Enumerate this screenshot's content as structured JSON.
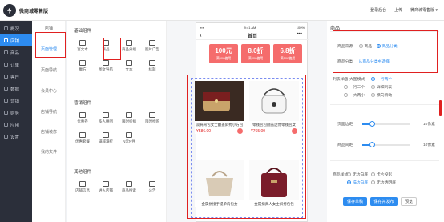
{
  "app": {
    "title": "微商城零售版"
  },
  "header": {
    "links": [
      "登录后台",
      "上传",
      "微商城零售版 ▾"
    ]
  },
  "sidebar": {
    "items": [
      {
        "label": "概况",
        "icon": "dashboard-icon"
      },
      {
        "label": "店铺",
        "icon": "shop-icon"
      },
      {
        "label": "商品",
        "icon": "goods-icon"
      },
      {
        "label": "订单",
        "icon": "order-icon"
      },
      {
        "label": "客户",
        "icon": "customer-icon"
      },
      {
        "label": "数据",
        "icon": "data-icon"
      },
      {
        "label": "营销",
        "icon": "marketing-icon"
      },
      {
        "label": "财务",
        "icon": "finance-icon"
      },
      {
        "label": "应用",
        "icon": "app-icon"
      },
      {
        "label": "设置",
        "icon": "settings-icon"
      }
    ]
  },
  "subnav": {
    "items": [
      "店铺",
      "页面管理",
      "页面导航",
      "会员中心",
      "店铺导航",
      "店铺装修",
      "我的文件"
    ]
  },
  "components": {
    "basic": {
      "title": "基础组件",
      "items": [
        "富文本",
        "商品",
        "商品分组",
        "图片广告",
        "魔方",
        "图文导航",
        "文本",
        "标题"
      ]
    },
    "marketing": {
      "title": "营销组件",
      "items": [
        "优惠券",
        "多人拼团",
        "限时折扣",
        "限时抢购",
        "优惠套餐",
        "满减满折",
        "N元N件"
      ]
    },
    "other": {
      "title": "其他组件",
      "items": [
        "店铺信息",
        "进入店铺",
        "商品搜索",
        "公告"
      ]
    }
  },
  "phone": {
    "time": "9:41 AM",
    "battery": "100%",
    "title": "首页",
    "back": "‹",
    "more": "•••"
  },
  "coupons": [
    {
      "amount": "100元",
      "label": "满500使用"
    },
    {
      "amount": "8.0折",
      "label": "满200使用"
    },
    {
      "amount": "6.8折",
      "label": "满100使用"
    }
  ],
  "products": [
    {
      "name": "双肩背包女士翻盖斜挎小方包",
      "price": "¥586.00"
    },
    {
      "name": "零钱包包翻盖迷你零钱包女",
      "price": "¥765.00"
    },
    {
      "name": "金属拼接手提单肩包女",
      "price": ""
    },
    {
      "name": "金属扣真人女士斜挎包包",
      "price": ""
    }
  ],
  "panel": {
    "title": "商品",
    "source_label": "商品来源",
    "source_opt1": "商品",
    "source_opt2": "商品分类",
    "group_label": "商品分类",
    "group_value": "从商品分类中选择",
    "list_label": "列表样式",
    "list_opts": [
      "大图模式",
      "一行两个",
      "一行三个",
      "详细列表",
      "一大两小",
      "横向滑动"
    ],
    "pad_label": "页面边距",
    "pad_value": "10像素",
    "gap_label": "商品间距",
    "gap_value": "10像素",
    "style_label": "商品样式",
    "style_opts": [
      "无边白底",
      "卡片投影",
      "描边白底",
      "无边透明底"
    ],
    "btn_save": "保存草稿",
    "btn_publish": "保存并发布",
    "btn_preview": "预览"
  }
}
